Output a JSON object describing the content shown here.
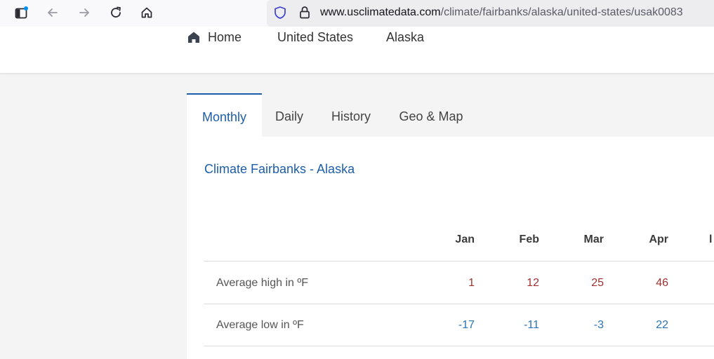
{
  "browser": {
    "url_host": "www.usclimatedata.com",
    "url_path": "/climate/fairbanks/alaska/united-states/usak0083",
    "icons": [
      "sidebar-toggle-icon",
      "back-arrow-icon",
      "forward-arrow-icon",
      "reload-icon",
      "home-icon",
      "shield-icon",
      "lock-icon"
    ]
  },
  "breadcrumb": {
    "home": "Home",
    "country": "United States",
    "state": "Alaska"
  },
  "tabs": [
    {
      "label": "Monthly",
      "active": true
    },
    {
      "label": "Daily",
      "active": false
    },
    {
      "label": "History",
      "active": false
    },
    {
      "label": "Geo & Map",
      "active": false
    }
  ],
  "panel": {
    "title": "Climate Fairbanks - Alaska"
  },
  "table": {
    "months": [
      "Jan",
      "Feb",
      "Mar",
      "Apr"
    ],
    "rows": [
      {
        "label": "Average high in ºF",
        "values": [
          "1",
          "12",
          "25",
          "46"
        ]
      },
      {
        "label": "Average low in ºF",
        "values": [
          "-17",
          "-11",
          "-3",
          "22"
        ]
      }
    ]
  },
  "colors": {
    "accent": "#1d5ea8",
    "high": "#a03030",
    "low": "#2b73b8"
  }
}
